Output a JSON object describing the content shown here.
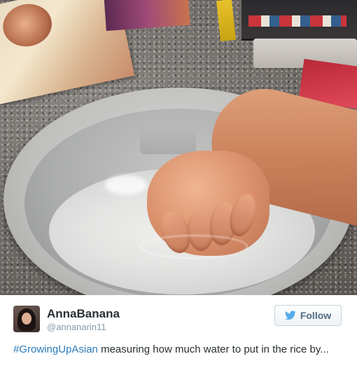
{
  "tweet": {
    "display_name": "AnnaBanana",
    "handle": "@annanarin11",
    "follow_label": "Follow",
    "hashtag": "#GrowingUpAsian",
    "text": " measuring how much water to put in the rice by..."
  },
  "icons": {
    "follow_icon": "twitter-bird-icon"
  },
  "colors": {
    "hashtag": "#2b7bb9",
    "name": "#292f33",
    "handle": "#8899a6",
    "follow_text": "#4f6c85",
    "twitter_blue": "#55acee"
  }
}
